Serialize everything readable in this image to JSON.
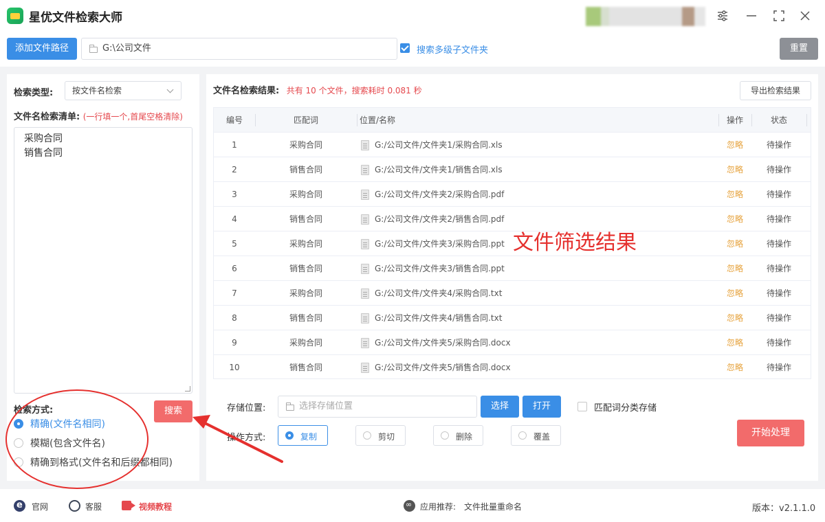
{
  "app": {
    "title": "星优文件检索大师"
  },
  "toolbar": {
    "add_path_label": "添加文件路径",
    "path_value": "G:\\公司文件",
    "multi_level_label": "搜索多级子文件夹",
    "multi_level_checked": true,
    "reset_label": "重置"
  },
  "left": {
    "type_label": "检索类型:",
    "type_value": "按文件名检索",
    "list_label": "文件名检索清单:",
    "list_hint": "(一行填一个,首尾空格清除)",
    "list_lines": [
      "采购合同",
      "销售合同"
    ],
    "mode_label": "检索方式:",
    "modes": [
      {
        "label": "精确(文件名相同)",
        "selected": true
      },
      {
        "label": "模糊(包含文件名)",
        "selected": false
      },
      {
        "label": "精确到格式(文件名和后缀都相同)",
        "selected": false
      }
    ],
    "search_label": "搜索"
  },
  "results": {
    "title": "文件名检索结果:",
    "summary": "共有 10 个文件，搜索耗时 0.081 秒",
    "export_label": "导出检索结果",
    "columns": [
      "编号",
      "匹配词",
      "位置/名称",
      "操作",
      "状态"
    ],
    "rows": [
      {
        "num": "1",
        "word": "采购合同",
        "path": "G:/公司文件/文件夹1/采购合同.xls",
        "action": "忽略",
        "status": "待操作"
      },
      {
        "num": "2",
        "word": "销售合同",
        "path": "G:/公司文件/文件夹1/销售合同.xls",
        "action": "忽略",
        "status": "待操作"
      },
      {
        "num": "3",
        "word": "采购合同",
        "path": "G:/公司文件/文件夹2/采购合同.pdf",
        "action": "忽略",
        "status": "待操作"
      },
      {
        "num": "4",
        "word": "销售合同",
        "path": "G:/公司文件/文件夹2/销售合同.pdf",
        "action": "忽略",
        "status": "待操作"
      },
      {
        "num": "5",
        "word": "采购合同",
        "path": "G:/公司文件/文件夹3/采购合同.ppt",
        "action": "忽略",
        "status": "待操作"
      },
      {
        "num": "6",
        "word": "销售合同",
        "path": "G:/公司文件/文件夹3/销售合同.ppt",
        "action": "忽略",
        "status": "待操作"
      },
      {
        "num": "7",
        "word": "采购合同",
        "path": "G:/公司文件/文件夹4/采购合同.txt",
        "action": "忽略",
        "status": "待操作"
      },
      {
        "num": "8",
        "word": "销售合同",
        "path": "G:/公司文件/文件夹4/销售合同.txt",
        "action": "忽略",
        "status": "待操作"
      },
      {
        "num": "9",
        "word": "采购合同",
        "path": "G:/公司文件/文件夹5/采购合同.docx",
        "action": "忽略",
        "status": "待操作"
      },
      {
        "num": "10",
        "word": "销售合同",
        "path": "G:/公司文件/文件夹5/销售合同.docx",
        "action": "忽略",
        "status": "待操作"
      }
    ],
    "overlay_caption": "文件筛选结果"
  },
  "options": {
    "store_label": "存储位置:",
    "store_placeholder": "选择存储位置",
    "choose_label": "选择",
    "open_label": "打开",
    "classify_label": "匹配词分类存储",
    "classify_checked": false,
    "op_label": "操作方式:",
    "ops": [
      {
        "label": "复制",
        "selected": true
      },
      {
        "label": "剪切",
        "selected": false
      },
      {
        "label": "删除",
        "selected": false
      },
      {
        "label": "覆盖",
        "selected": false
      }
    ],
    "start_label": "开始处理"
  },
  "footer": {
    "website_label": "官网",
    "service_label": "客服",
    "video_label": "视频教程",
    "recommend_prefix": "应用推荐:",
    "recommend_app": "文件批量重命名",
    "version_label": "版本：",
    "version_value": "v2.1.1.0"
  },
  "colors": {
    "primary": "#3a8ee6",
    "danger": "#f26b6b",
    "warning": "#e6a23c",
    "annotation": "#e5302e"
  }
}
